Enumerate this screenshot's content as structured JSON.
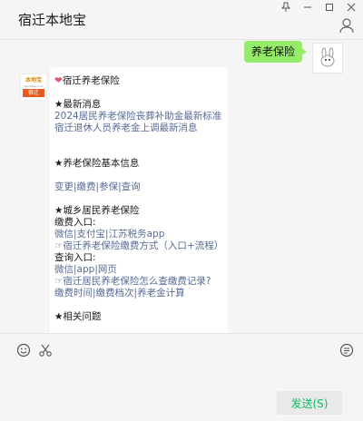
{
  "window": {
    "title": "宿迁本地宝",
    "pin_icon": "pin-icon",
    "minimize_icon": "minimize-icon",
    "maximize_icon": "maximize-icon",
    "close_icon": "close-icon"
  },
  "me_message": {
    "text": "养老保险"
  },
  "bot": {
    "avatar_top": "本地宝",
    "avatar_mid": "bendibao.com",
    "avatar_bar": "宿迁",
    "heart": "❤",
    "title": "宿迁养老保险",
    "news_header": "★最新消息",
    "news_1": "2024居民养老保险丧葬补助金最新标准",
    "news_2": "宿迁退休人员养老金上调最新消息",
    "basic_header": "★养老保险基本信息",
    "basic_links": [
      "变更",
      "缴费",
      "参保",
      "查询"
    ],
    "urban_header": "★城乡居民养老保险",
    "pay_entry_label": "缴费入口:",
    "pay_entry_links": [
      "微信",
      "支付宝",
      "江苏税务app"
    ],
    "pay_method": "☞宿迁养老保险缴费方式（入口+流程）",
    "query_entry_label": "查询入口:",
    "query_entry_links": [
      "微信",
      "app",
      "网页"
    ],
    "query_how": "☞宿迁居民养老保险怎么查缴费记录?",
    "query_more_links": [
      "缴费时间",
      "缴费档次",
      "养老金计算"
    ],
    "related_header": "★相关问题"
  },
  "toolbar": {
    "emoji_icon": "emoji-icon",
    "scissors_icon": "scissors-icon",
    "chat-history_icon": "chat-history-icon"
  },
  "input": {
    "send_label": "发送(S)"
  },
  "colors": {
    "bubble_me": "#95ec69",
    "link": "#576b95",
    "send_text": "#07c160",
    "avatar_bar": "#e85a1c"
  }
}
